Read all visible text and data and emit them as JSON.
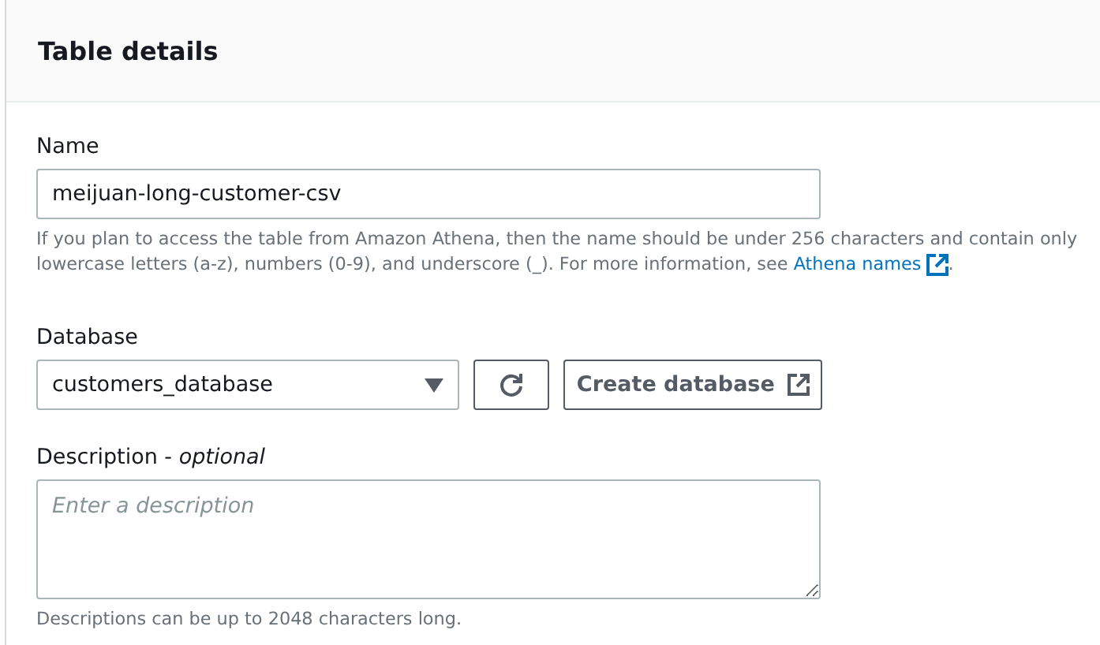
{
  "panel": {
    "title": "Table details"
  },
  "name_field": {
    "label": "Name",
    "value": "meijuan-long-customer-csv",
    "help_before": "If you plan to access the table from Amazon Athena, then the name should be under 256 characters and contain only lowercase letters (a-z), numbers (0-9), and underscore (_). For more information, see ",
    "help_link": "Athena names",
    "help_after": "."
  },
  "database_field": {
    "label": "Database",
    "value": "customers_database",
    "create_button": "Create database"
  },
  "description_field": {
    "label": "Description - *optional*",
    "placeholder": "Enter a description",
    "help": "Descriptions can be up to 2048 characters long."
  }
}
